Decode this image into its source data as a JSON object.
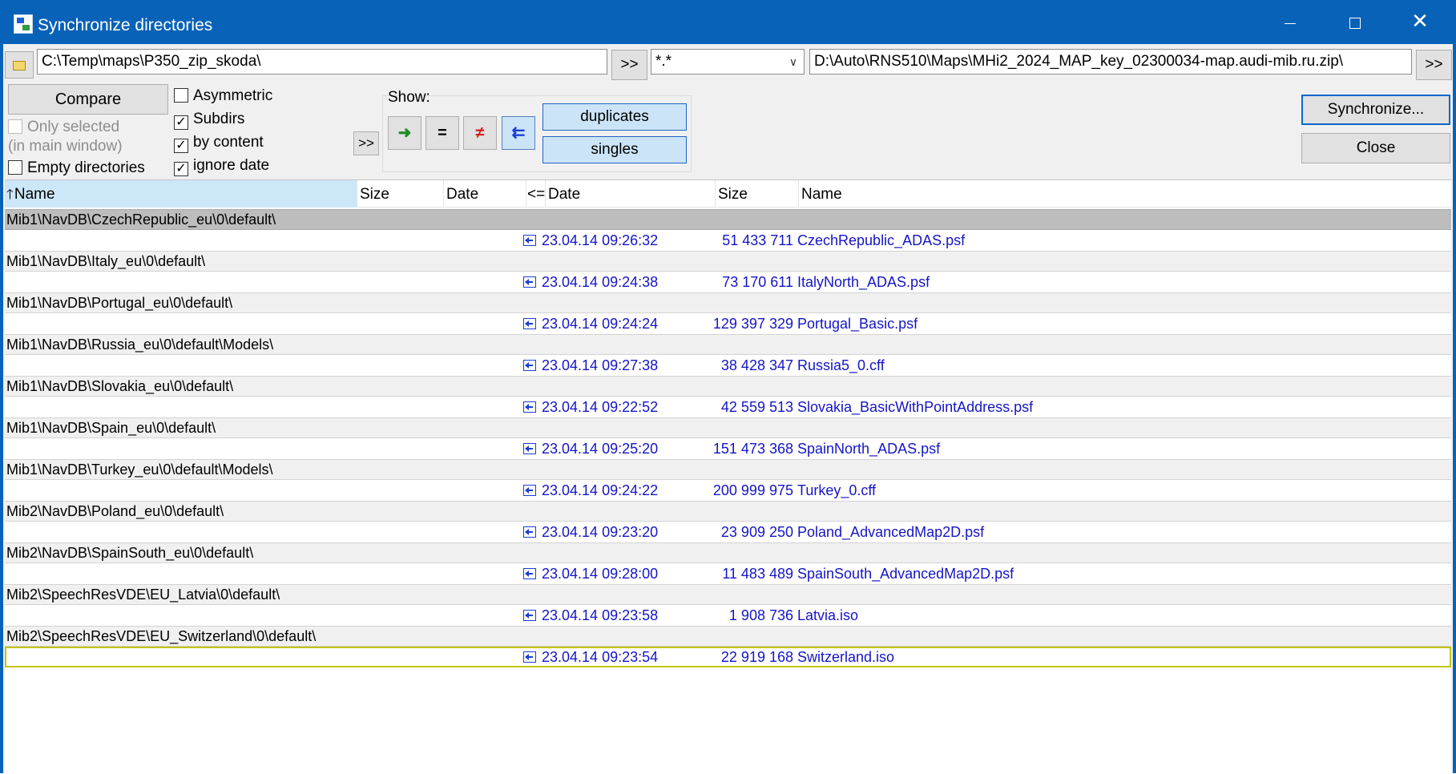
{
  "window": {
    "title": "Synchronize directories",
    "minimize_symbol": "–",
    "maximize_symbol": "□",
    "close_symbol": "✕"
  },
  "paths": {
    "left": "C:\\Temp\\maps\\P350_zip_skoda\\",
    "right": "D:\\Auto\\RNS510\\Maps\\MHi2_2024_MAP_key_02300034-map.audi-mib.ru.zip\\",
    "filter": "*.*",
    "arrow_label": ">>"
  },
  "options": {
    "compare_label": "Compare",
    "only_selected_label": "Only selected",
    "in_main_window_label": "(in main window)",
    "empty_directories_label": "Empty directories",
    "asymmetric_label": "Asymmetric",
    "subdirs_label": "Subdirs",
    "by_content_label": "by content",
    "ignore_date_label": "ignore date",
    "more_label": ">>",
    "checked_mark": "✓"
  },
  "show": {
    "label": "Show:",
    "right_symbol": "➜",
    "equal_symbol": "=",
    "diff_symbol": "≠",
    "left_symbol": "⇇",
    "duplicates_label": "duplicates",
    "singles_label": "singles"
  },
  "actions": {
    "synchronize_label": "Synchronize...",
    "close_label": "Close"
  },
  "columns": {
    "sort_icon": "🡑",
    "name": "Name",
    "size_left": "Size",
    "date_left": "Date",
    "compare": "<=",
    "date_right": "Date",
    "size_right": "Size",
    "name_right": "Name"
  },
  "groups": [
    {
      "dir": "Mib1\\NavDB\\CzechRepublic_eu\\0\\default\\",
      "date": "23.04.14 09:26:32",
      "size": "51 433 711",
      "name": "CzechRepublic_ADAS.psf"
    },
    {
      "dir": "Mib1\\NavDB\\Italy_eu\\0\\default\\",
      "date": "23.04.14 09:24:38",
      "size": "73 170 611",
      "name": "ItalyNorth_ADAS.psf"
    },
    {
      "dir": "Mib1\\NavDB\\Portugal_eu\\0\\default\\",
      "date": "23.04.14 09:24:24",
      "size": "129 397 329",
      "name": "Portugal_Basic.psf"
    },
    {
      "dir": "Mib1\\NavDB\\Russia_eu\\0\\default\\Models\\",
      "date": "23.04.14 09:27:38",
      "size": "38 428 347",
      "name": "Russia5_0.cff"
    },
    {
      "dir": "Mib1\\NavDB\\Slovakia_eu\\0\\default\\",
      "date": "23.04.14 09:22:52",
      "size": "42 559 513",
      "name": "Slovakia_BasicWithPointAddress.psf"
    },
    {
      "dir": "Mib1\\NavDB\\Spain_eu\\0\\default\\",
      "date": "23.04.14 09:25:20",
      "size": "151 473 368",
      "name": "SpainNorth_ADAS.psf"
    },
    {
      "dir": "Mib1\\NavDB\\Turkey_eu\\0\\default\\Models\\",
      "date": "23.04.14 09:24:22",
      "size": "200 999 975",
      "name": "Turkey_0.cff"
    },
    {
      "dir": "Mib2\\NavDB\\Poland_eu\\0\\default\\",
      "date": "23.04.14 09:23:20",
      "size": "23 909 250",
      "name": "Poland_AdvancedMap2D.psf"
    },
    {
      "dir": "Mib2\\NavDB\\SpainSouth_eu\\0\\default\\",
      "date": "23.04.14 09:28:00",
      "size": "11 483 489",
      "name": "SpainSouth_AdvancedMap2D.psf"
    },
    {
      "dir": "Mib2\\SpeechResVDE\\EU_Latvia\\0\\default\\",
      "date": "23.04.14 09:23:58",
      "size": "1 908 736",
      "name": "Latvia.iso"
    },
    {
      "dir": "Mib2\\SpeechResVDE\\EU_Switzerland\\0\\default\\",
      "date": "23.04.14 09:23:54",
      "size": "22 919 168",
      "name": "Switzerland.iso"
    }
  ]
}
